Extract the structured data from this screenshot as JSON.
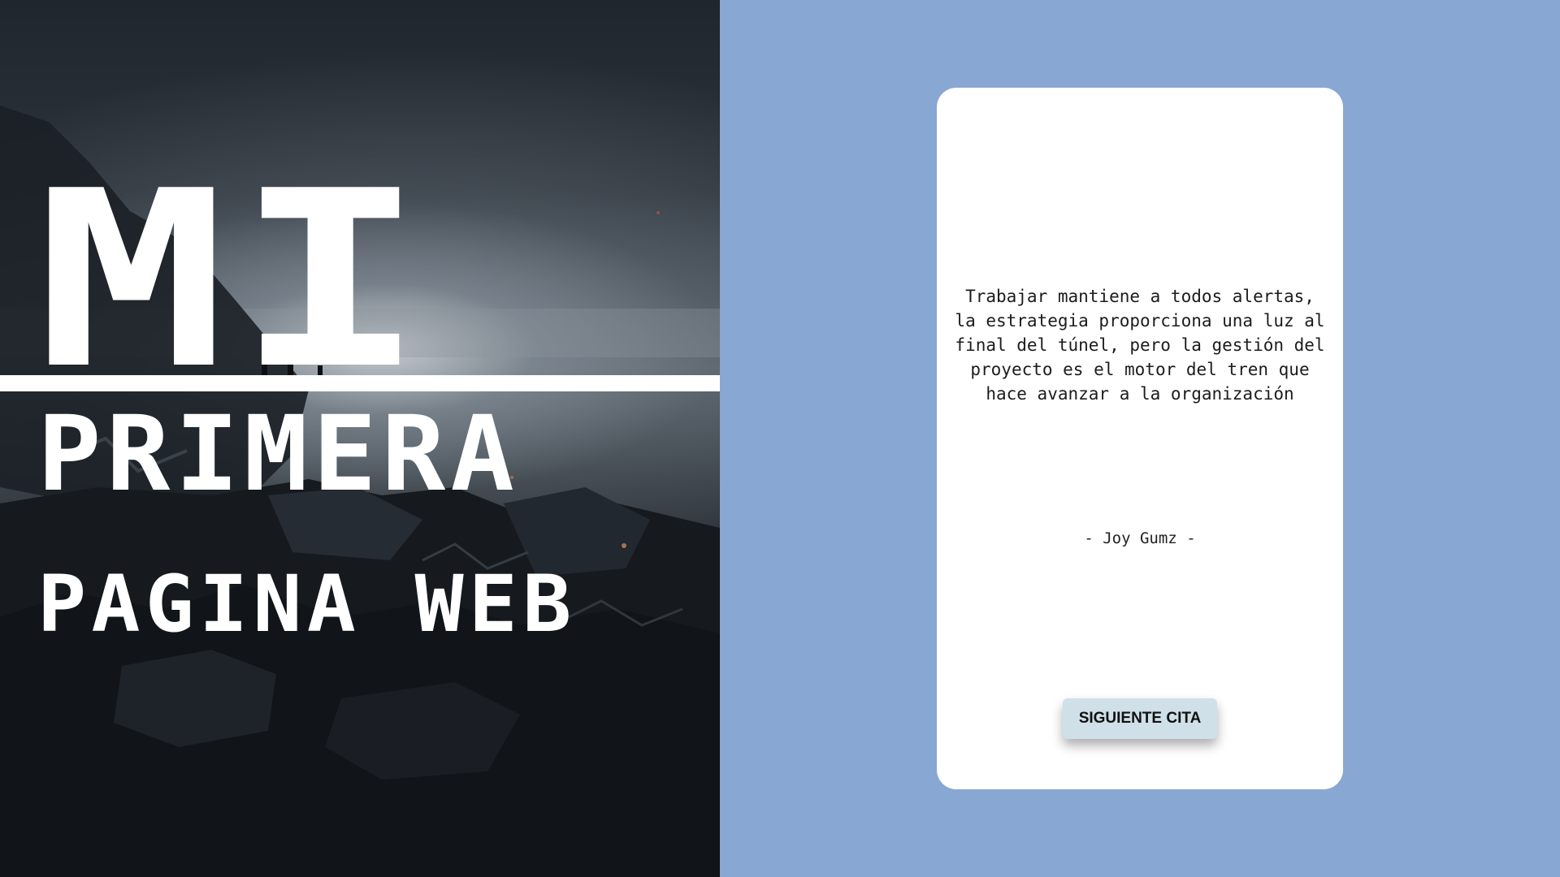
{
  "hero": {
    "title_line1": "MI",
    "title_line2": "PRIMERA",
    "title_line3": "PAGINA WEB",
    "background_image": "dark-apocalyptic-rubble-landscape"
  },
  "quote": {
    "text": "Trabajar mantiene a todos alertas, la estrategia proporciona una luz al final del túnel, pero la gestión del proyecto es el motor del tren que hace avanzar a la organización",
    "author": "- Joy Gumz -"
  },
  "actions": {
    "next_label": "SIGUIENTE CITA"
  },
  "colors": {
    "panel_background": "#88a7d2",
    "card_background": "#ffffff",
    "button_background": "#cfe0e9",
    "title_text": "#ffffff"
  }
}
